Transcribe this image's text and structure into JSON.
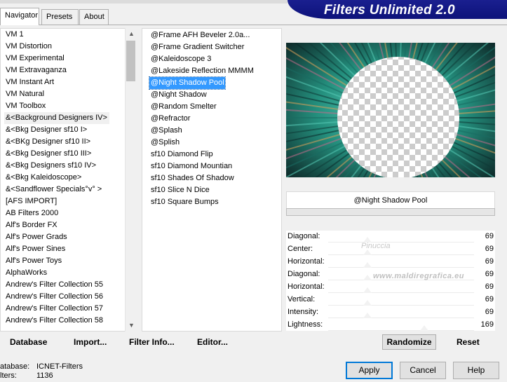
{
  "title": "Filters Unlimited 2.0",
  "tabs": [
    "Navigator",
    "Presets",
    "About"
  ],
  "categories": [
    "VM 1",
    "VM Distortion",
    "VM Experimental",
    "VM Extravaganza",
    "VM Instant Art",
    "VM Natural",
    "VM Toolbox",
    "&<Background Designers IV>",
    "&<Bkg Designer sf10 I>",
    "&<BKg Designer sf10 II>",
    "&<Bkg Designer sf10 III>",
    "&<Bkg Designers sf10 IV>",
    "&<Bkg Kaleidoscope>",
    "&<Sandflower Specials°v° >",
    "[AFS IMPORT]",
    "AB Filters 2000",
    "Alf's Border FX",
    "Alf's Power Grads",
    "Alf's Power Sines",
    "Alf's Power Toys",
    "AlphaWorks",
    "Andrew's Filter Collection 55",
    "Andrew's Filter Collection 56",
    "Andrew's Filter Collection 57",
    "Andrew's Filter Collection 58"
  ],
  "selected_category": "&<Background Designers IV>",
  "filters": [
    "@Frame AFH Beveler 2.0a...",
    "@Frame Gradient Switcher",
    "@Kaleidoscope 3",
    "@Lakeside Reflection MMMM",
    "@Night Shadow Pool",
    "@Night Shadow",
    "@Random Smelter",
    "@Refractor",
    "@Splash",
    "@Splish",
    "sf10 Diamond Flip",
    "sf10 Diamond Mountian",
    "sf10 Shades Of Shadow",
    "sf10 Slice N Dice",
    "sf10 Square Bumps"
  ],
  "selected_filter": "@Night Shadow Pool",
  "filter_name_display": "@Night Shadow Pool",
  "params": [
    {
      "label": "Diagonal:",
      "value": "69",
      "level": 0.27
    },
    {
      "label": "Center:",
      "value": "69",
      "level": 0.27
    },
    {
      "label": "Horizontal:",
      "value": "69",
      "level": 0.27
    },
    {
      "label": "Diagonal:",
      "value": "69",
      "level": 0.27
    },
    {
      "label": "Horizontal:",
      "value": "69",
      "level": 0.27
    },
    {
      "label": "Vertical:",
      "value": "69",
      "level": 0.27
    },
    {
      "label": "Intensity:",
      "value": "69",
      "level": 0.27
    },
    {
      "label": "Lightness:",
      "value": "169",
      "level": 0.66
    }
  ],
  "watermark": {
    "name": "Pinuccia",
    "site": "www.maldiregrafica.eu"
  },
  "links": {
    "database": "Database",
    "import": "Import...",
    "filter_info": "Filter Info...",
    "editor": "Editor..."
  },
  "randomize": "Randomize",
  "reset": "Reset",
  "status": {
    "database_label": "atabase:",
    "database_value": "ICNET-Filters",
    "filters_label": "lters:",
    "filters_value": "1136"
  },
  "buttons": {
    "apply": "Apply",
    "cancel": "Cancel",
    "help": "Help"
  },
  "colors": {
    "banner": "#14198a",
    "selection": "#3399ff",
    "preview_teal": "#2a9c8a"
  }
}
